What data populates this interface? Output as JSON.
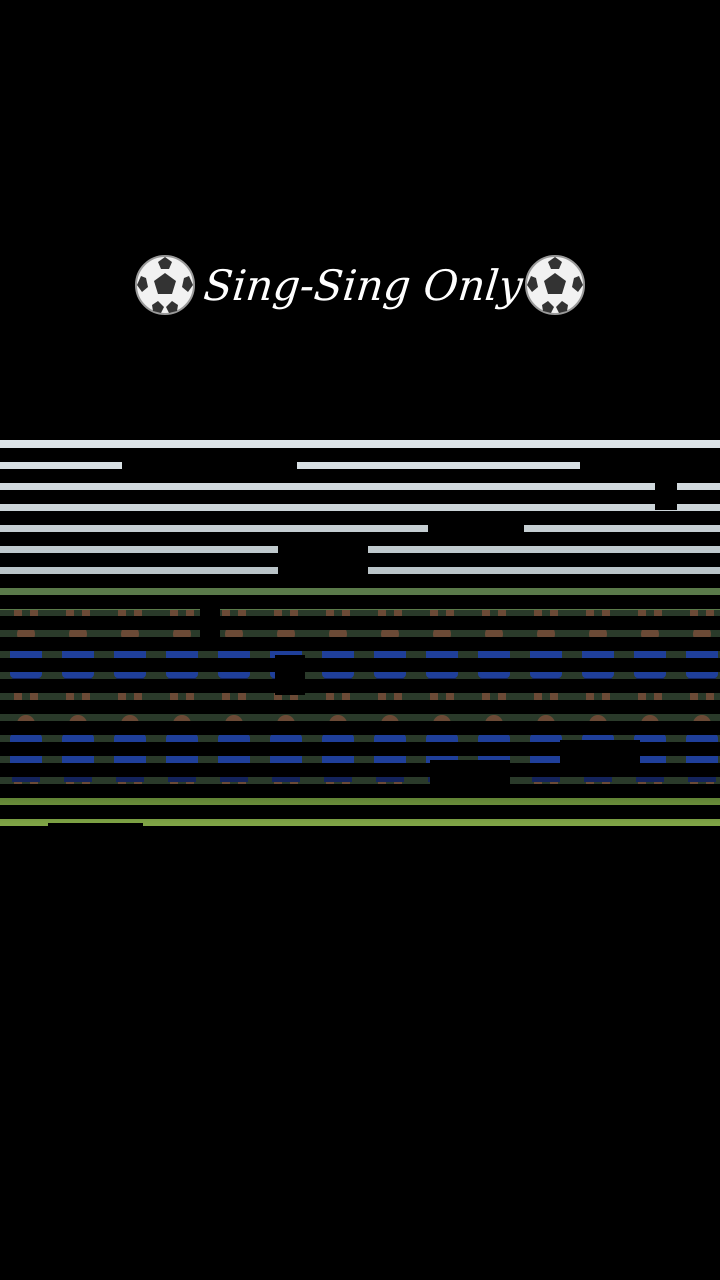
{
  "caption": {
    "text": "Sing-Sing Only",
    "leading_icon": "soccer-ball-icon",
    "trailing_icon": "soccer-ball-icon"
  },
  "photo": {
    "subject": "team-photo-glitch-effect",
    "colors": {
      "sky": "#c9d3d9",
      "grass": "#7aa043",
      "jersey": "#1f3f9a",
      "background": "#000000"
    }
  }
}
